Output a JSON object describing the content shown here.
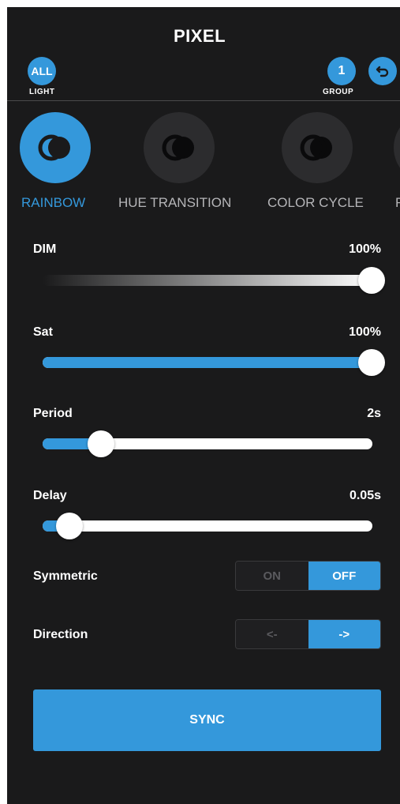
{
  "header": {
    "title": "PIXEL",
    "all_label": "ALL",
    "light_label": "LIGHT",
    "group_number": "1",
    "group_label": "GROUP",
    "undo_icon": "undo-arrow-icon"
  },
  "effects": [
    {
      "label": "RAINBOW",
      "active": true,
      "icon": "overlapping-circles-icon"
    },
    {
      "label": "HUE TRANSITION",
      "active": false,
      "icon": "overlapping-circles-icon"
    },
    {
      "label": "COLOR CYCLE",
      "active": false,
      "icon": "overlapping-circles-icon"
    },
    {
      "label": "F",
      "active": false,
      "icon": "overlapping-circles-icon"
    }
  ],
  "controls": {
    "dim": {
      "label": "DIM",
      "value": "100%",
      "level": 1.0
    },
    "sat": {
      "label": "Sat",
      "value": "100%",
      "level": 1.0
    },
    "period": {
      "label": "Period",
      "value": "2s",
      "level": 0.18
    },
    "delay": {
      "label": "Delay",
      "value": "0.05s",
      "level": 0.08
    }
  },
  "symmetric": {
    "label": "Symmetric",
    "on_label": "ON",
    "off_label": "OFF",
    "selected": "OFF"
  },
  "direction": {
    "label": "Direction",
    "left_label": "<-",
    "right_label": "->",
    "selected": "->"
  },
  "sync_label": "SYNC",
  "colors": {
    "accent": "#3498db",
    "background": "#1a1a1b",
    "inactive_circle": "#2c2c2e"
  }
}
